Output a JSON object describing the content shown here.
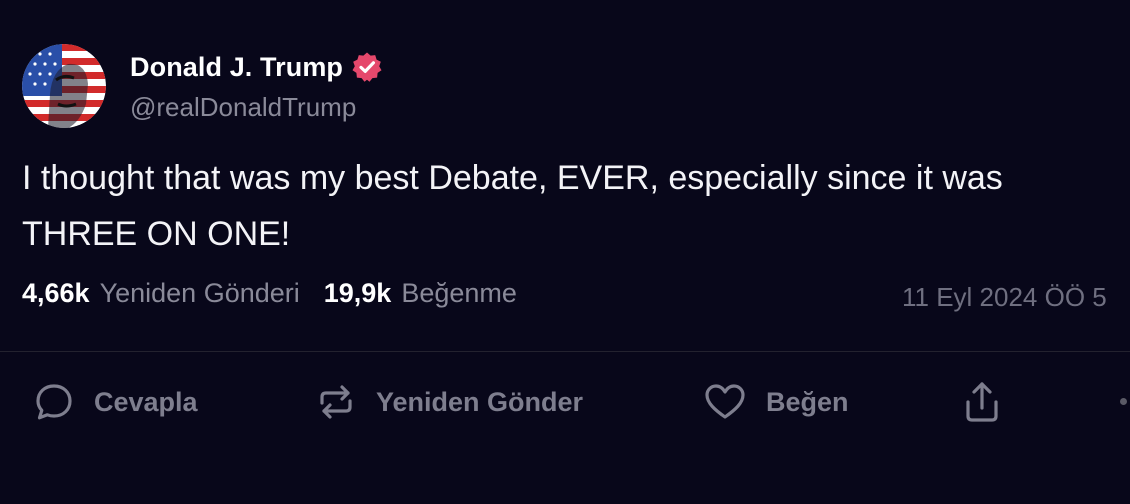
{
  "author": {
    "name": "Donald J. Trump",
    "handle": "@realDonaldTrump",
    "verified_color": "#e5486c"
  },
  "post": {
    "line1": "I thought that was my best Debate, EVER, especially since it was",
    "line2": "THREE ON ONE!"
  },
  "stats": {
    "reposts_count": "4,66k",
    "reposts_label": "Yeniden Gönderi",
    "likes_count": "19,9k",
    "likes_label": "Beğenme",
    "timestamp": "11 Eyl 2024 ÖÖ 5"
  },
  "actions": {
    "reply_label": "Cevapla",
    "repost_label": "Yeniden Gönder",
    "like_label": "Beğen",
    "share_icon": "share-icon"
  }
}
